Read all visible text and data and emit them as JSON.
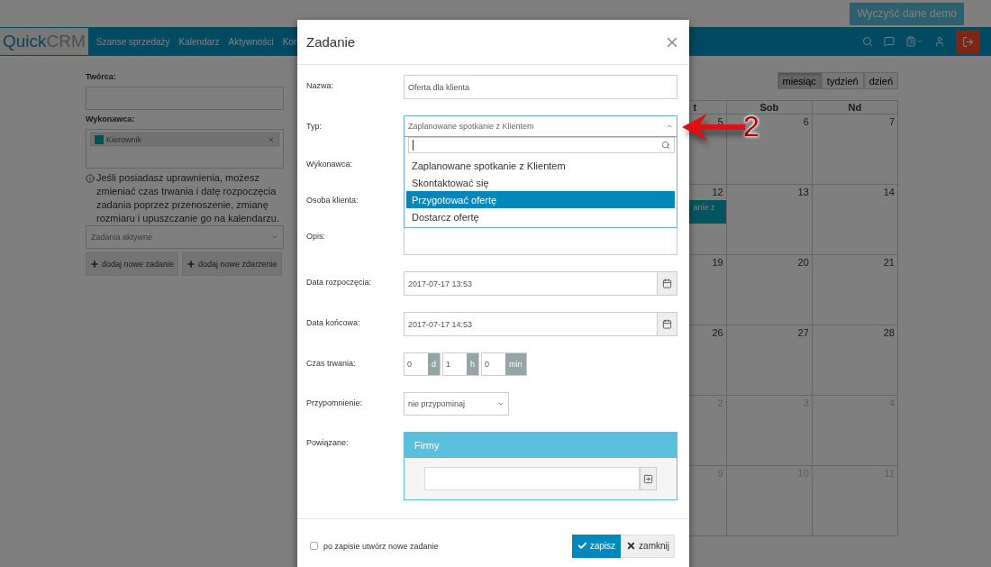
{
  "top_bar": {
    "demo_button": "Wyczyść dane demo"
  },
  "navbar": {
    "logo": {
      "first": "Quick",
      "second": "CRM"
    },
    "items": [
      "Szanse sprzedaży",
      "Kalendarz",
      "Aktywności",
      "Kon"
    ]
  },
  "sidebar": {
    "creator_label": "Twórca:",
    "assignee_label": "Wykonawca:",
    "assignee_tags": [
      {
        "label": "Kierownik"
      }
    ],
    "info_text": "Jeśli posiadasz uprawnienia, możesz zmieniać czas trwania i datę rozpoczęcia zadania poprzez przenoszenie, zmianę rozmiaru i upuszczanie go na kalendarzu.",
    "filter_select": "Zadania aktywne",
    "buttons": [
      "dodaj nowe zadanie",
      "dodaj nowe zdarzenie"
    ]
  },
  "calendar": {
    "views": [
      {
        "label": "miesiąc",
        "selected": true
      },
      {
        "label": "tydzień",
        "selected": false
      },
      {
        "label": "dzień",
        "selected": false
      }
    ],
    "columns": [
      "t",
      "Sob",
      "Nd"
    ],
    "weeks": [
      {
        "days": [
          {
            "date": "5",
            "other_month": false
          },
          {
            "date": "6",
            "other_month": false
          },
          {
            "date": "7",
            "other_month": false
          }
        ]
      },
      {
        "days": [
          {
            "date": "12",
            "other_month": false
          },
          {
            "date": "13",
            "other_month": false
          },
          {
            "date": "14",
            "other_month": false
          }
        ],
        "event": "anie z"
      },
      {
        "days": [
          {
            "date": "19",
            "other_month": false
          },
          {
            "date": "20",
            "other_month": false
          },
          {
            "date": "21",
            "other_month": false
          }
        ]
      },
      {
        "days": [
          {
            "date": "26",
            "other_month": false
          },
          {
            "date": "27",
            "other_month": false
          },
          {
            "date": "28",
            "other_month": false
          }
        ]
      },
      {
        "days": [
          {
            "date": "2",
            "other_month": true
          },
          {
            "date": "3",
            "other_month": true
          },
          {
            "date": "4",
            "other_month": true
          }
        ]
      },
      {
        "days": [
          {
            "date": "9",
            "other_month": true
          },
          {
            "date": "10",
            "other_month": true
          },
          {
            "date": "11",
            "other_month": true
          }
        ]
      }
    ]
  },
  "modal": {
    "title": "Zadanie",
    "fields": [
      {
        "kind": "text",
        "label": "Nazwa:",
        "value": "Oferta dla klienta"
      },
      {
        "kind": "select_open",
        "label": "Typ:",
        "value": "Zaplanowane spotkanie z Klientem",
        "options": [
          {
            "label": "Zaplanowane spotkanie z Klientem",
            "highlighted": false
          },
          {
            "label": "Skontaktować się",
            "highlighted": false
          },
          {
            "label": "Przygotować ofertę",
            "highlighted": true
          },
          {
            "label": "Dostarcz ofertę",
            "highlighted": false
          }
        ]
      },
      {
        "kind": "covered",
        "label": "Wykonawca:"
      },
      {
        "kind": "covered",
        "label": "Osoba klienta:"
      },
      {
        "kind": "textarea",
        "label": "Opis:"
      },
      {
        "kind": "date",
        "label": "Data rozpoczęcia:",
        "value": "2017-07-17 13:53"
      },
      {
        "kind": "date",
        "label": "Data końcowa:",
        "value": "2017-07-17 14:53"
      },
      {
        "kind": "duration",
        "label": "Czas trwania:",
        "parts": [
          {
            "value": "0",
            "unit": "d"
          },
          {
            "value": "1",
            "unit": "h"
          },
          {
            "value": "0",
            "unit": "min"
          }
        ]
      },
      {
        "kind": "select",
        "label": "Przypomnienie:",
        "value": "nie przypominaj"
      },
      {
        "kind": "related",
        "label": "Powiązane:",
        "panel_title": "Firmy"
      }
    ],
    "footer": {
      "checkbox": {
        "label": "po zapisie utwórz nowe zadanie",
        "checked": false
      },
      "save_button": "zapisz",
      "close_button": "zamknij"
    }
  },
  "annotation": {
    "label": "2"
  }
}
